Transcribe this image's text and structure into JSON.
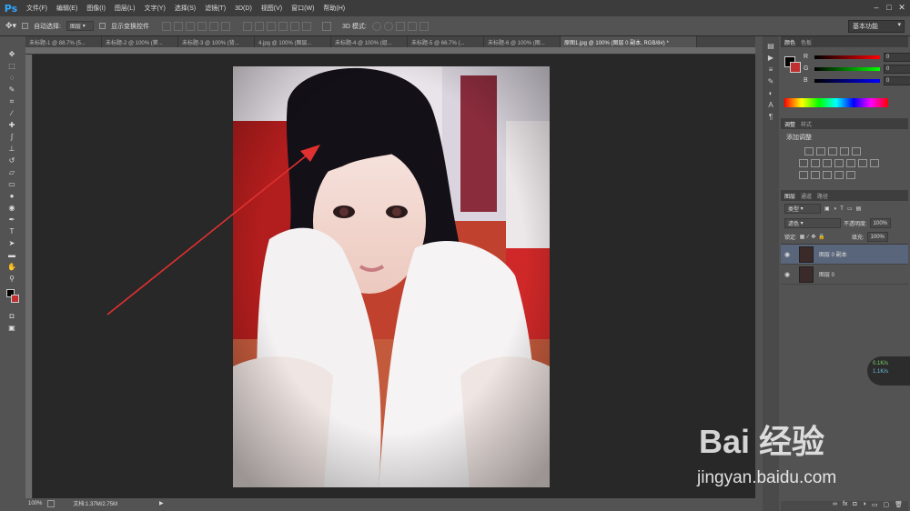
{
  "app": {
    "logo": "Ps"
  },
  "menu": [
    "文件(F)",
    "编辑(E)",
    "图像(I)",
    "图层(L)",
    "文字(Y)",
    "选择(S)",
    "滤镜(T)",
    "3D(D)",
    "视图(V)",
    "窗口(W)",
    "帮助(H)"
  ],
  "options": {
    "auto_select_label": "自动选择:",
    "auto_select_value": "图层",
    "show_transform_label": "显示变换控件",
    "mode_3d_label": "3D 模式:",
    "workspace": "基本功能"
  },
  "tabs": [
    "未标题-1 @ 88.7% (5...",
    "未标题-2 @ 100% (第...",
    "未标题-3 @ 100% (背...",
    "4.jpg @ 100% (图层...",
    "未标题-4 @ 100% (组...",
    "未标题-5 @ 66.7% (...",
    "未标题-6 @ 100% (图...",
    "原图1.jpg @ 100% (图层 0 副本, RGB/8#) *"
  ],
  "status": {
    "zoom": "100%",
    "doc": "文档:1.37M/2.75M"
  },
  "color_panel": {
    "tabs": [
      "颜色",
      "色板"
    ],
    "channels": [
      {
        "label": "R",
        "value": "0"
      },
      {
        "label": "G",
        "value": "0"
      },
      {
        "label": "B",
        "value": "0"
      }
    ]
  },
  "adjust_panel": {
    "tabs": [
      "调整",
      "样式"
    ],
    "title": "添加调整"
  },
  "layers_panel": {
    "tabs": [
      "图层",
      "通道",
      "路径"
    ],
    "filter": "类型",
    "blend_mode": "滤色",
    "opacity_label": "不透明度:",
    "opacity_value": "100%",
    "lock_label": "锁定:",
    "fill_label": "填充:",
    "fill_value": "100%",
    "layers": [
      {
        "name": "图层 0 副本",
        "selected": true
      },
      {
        "name": "图层 0",
        "selected": false
      }
    ]
  },
  "net_widget": {
    "up": "0.1K/s",
    "down": "1.1K/s"
  },
  "watermark": {
    "logo": "Bai 经验",
    "url": "jingyan.baidu.com"
  },
  "colors": {
    "accent": "#31a8ff",
    "selected_layer": "#59657a",
    "arrow": "#e03030"
  }
}
